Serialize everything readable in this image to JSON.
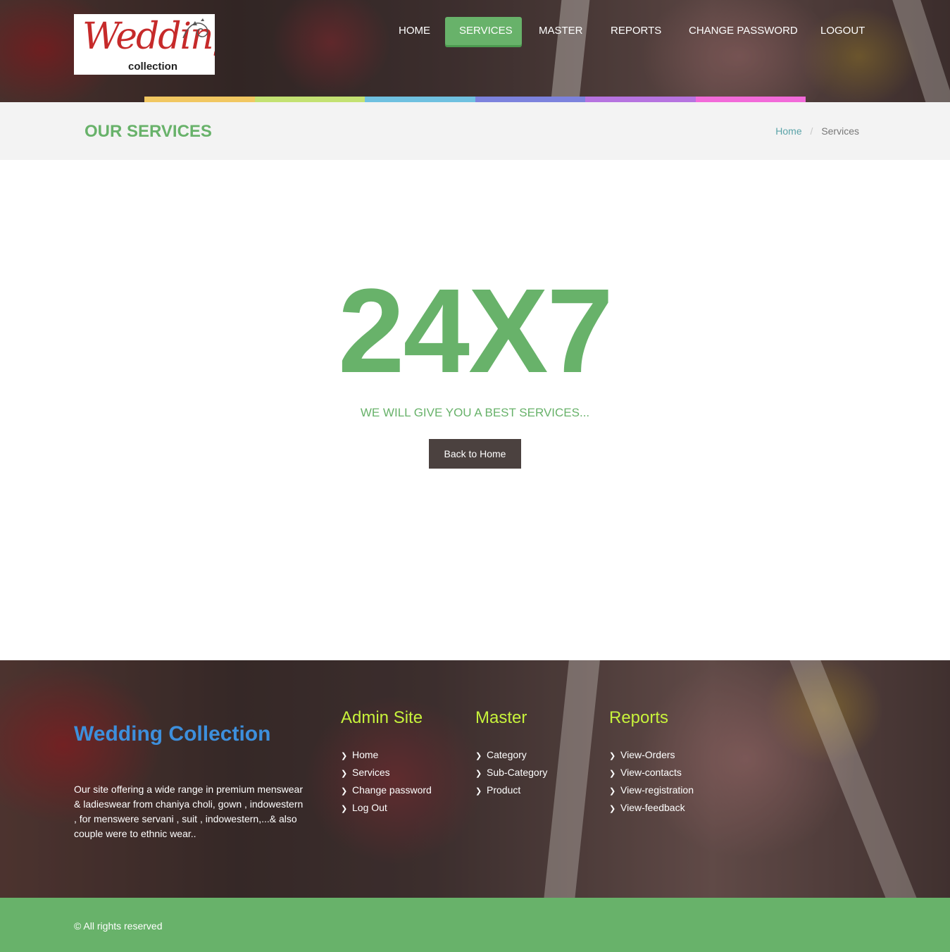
{
  "logo": {
    "script_text": "Wedding",
    "sub_text": "collection"
  },
  "nav": {
    "items": [
      {
        "label": "HOME",
        "active": false
      },
      {
        "label": "SERVICES",
        "active": true
      },
      {
        "label": "MASTER",
        "active": false
      },
      {
        "label": "REPORTS",
        "active": false
      },
      {
        "label": "CHANGE PASSWORD",
        "active": false
      },
      {
        "label": "LOGOUT",
        "active": false
      }
    ]
  },
  "color_bar": [
    "#f1c761",
    "#c3e172",
    "#6fc0e0",
    "#7c82dd",
    "#b673e0",
    "#f26ad9"
  ],
  "title_bar": {
    "title": "OUR SERVICES",
    "breadcrumb": {
      "home": "Home",
      "separator": "/",
      "current": "Services"
    }
  },
  "main": {
    "headline": "24X7",
    "tagline": "WE WILL GIVE YOU A BEST SERVICES...",
    "button_label": "Back to Home"
  },
  "footer": {
    "brand_title": "Wedding Collection",
    "brand_desc": "Our site offering a wide range in premium menswear & ladieswear from chaniya choli, gown , indowestern , for menswere servani , suit , indowestern,...& also couple were to ethnic wear..",
    "columns": [
      {
        "title": "Admin Site",
        "links": [
          "Home",
          "Services",
          "Change password",
          "Log Out"
        ]
      },
      {
        "title": "Master",
        "links": [
          "Category",
          "Sub-Category",
          "Product"
        ]
      },
      {
        "title": "Reports",
        "links": [
          "View-Orders",
          "View-contacts",
          "View-registration",
          "View-feedback"
        ]
      }
    ],
    "copyright": "© All rights reserved"
  },
  "colors": {
    "accent_green": "#68b26a",
    "button_dark": "#4b413f",
    "footer_heading": "#c7f23b",
    "brand_blue": "#3d8fdc"
  },
  "icons": {
    "list_bullet": "chevron-right-icon"
  }
}
